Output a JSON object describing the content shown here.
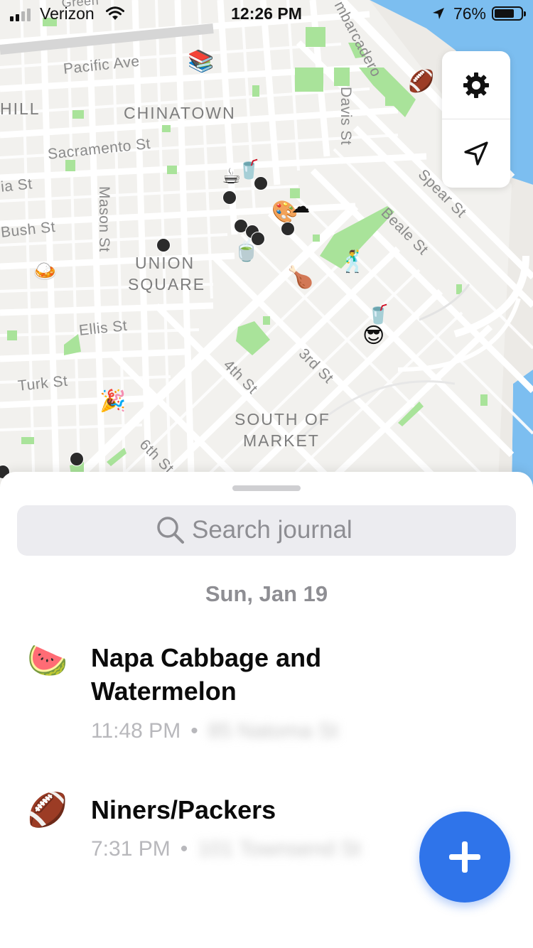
{
  "status_bar": {
    "carrier": "Verizon",
    "time": "12:26 PM",
    "battery": "76%",
    "battery_level": 0.76
  },
  "map": {
    "district_labels": [
      "CHINATOWN",
      "UNION",
      "SQUARE",
      "SOUTH OF",
      "MARKET",
      "HILL"
    ],
    "street_labels": [
      "Pacific Ave",
      "Sacramento St",
      "Bush St",
      "Mason St",
      "Ellis St",
      "Turk St",
      "4th St",
      "3rd St",
      "6th St",
      "Spear St",
      "Beale St",
      "Davis St",
      "mbarcadero",
      "ia St",
      "Green"
    ],
    "markers": [
      "books",
      "coffee",
      "drink-cup",
      "palette",
      "cloud",
      "tea-bowl",
      "drumstick",
      "dancer",
      "soda-cup",
      "sunglasses-face",
      "party-popper",
      "curry-bowl",
      "football"
    ]
  },
  "controls": {
    "settings_icon": "gear-icon",
    "locate_icon": "location-arrow-icon"
  },
  "sheet": {
    "search_placeholder": "Search journal",
    "date_header": "Sun, Jan 19",
    "entries": [
      {
        "emoji": "🍉",
        "icon": "watermelon-icon",
        "title": "Napa Cabbage and Watermelon",
        "time": "11:48 PM",
        "location": "85 Natoma St"
      },
      {
        "emoji": "🏈",
        "icon": "football-icon",
        "title": "Niners/Packers",
        "time": "7:31 PM",
        "location": "101 Townsend St"
      }
    ],
    "fab_icon": "plus-icon"
  },
  "colors": {
    "accent": "#2f74ea",
    "map_bg": "#f2f1ee",
    "park": "#a9e39a",
    "water": "#7cbef0"
  }
}
